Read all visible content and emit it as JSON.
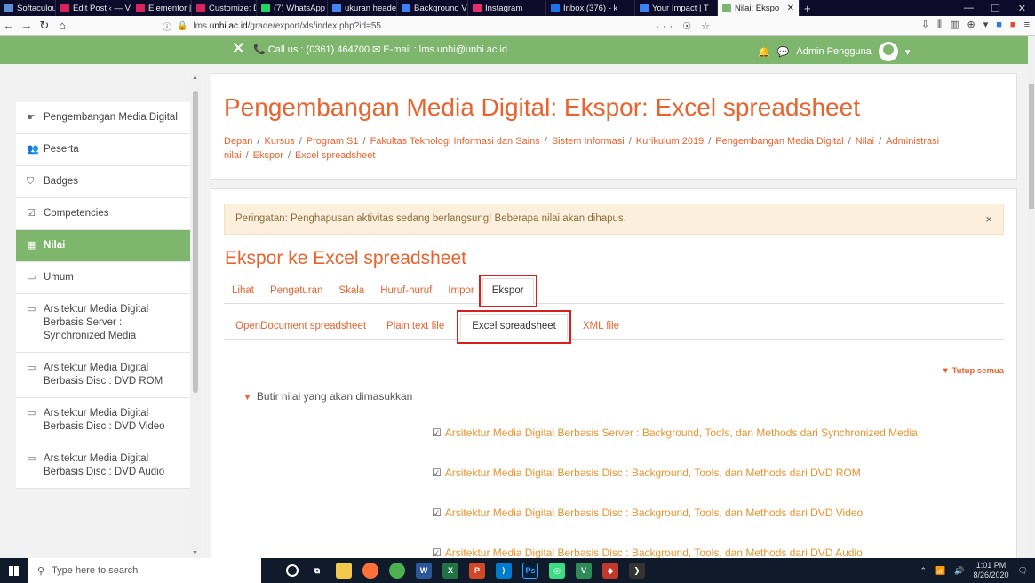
{
  "browser": {
    "tabs": [
      {
        "label": "Softaculous - S",
        "color": "#5a8fd8"
      },
      {
        "label": "Edit Post ‹ — V",
        "color": "#d8245a"
      },
      {
        "label": "Elementor | De",
        "color": "#d8245a"
      },
      {
        "label": "Customize: De",
        "color": "#d8245a"
      },
      {
        "label": "(7) WhatsApp",
        "color": "#25d366"
      },
      {
        "label": "ukuran header",
        "color": "#4285f4"
      },
      {
        "label": "Background V",
        "color": "#3b82f6"
      },
      {
        "label": "Instagram",
        "color": "#e1306c"
      },
      {
        "label": "Inbox (376) - k",
        "color": "#1a73e8"
      },
      {
        "label": "Your Impact | T",
        "color": "#3b82f6"
      },
      {
        "label": "Nilai: Ekspo",
        "color": "#7fb66d",
        "active": true
      }
    ],
    "url_prefix": "lms.",
    "url_domain": "unhi.ac.id",
    "url_path": "/grade/export/xls/index.php?id=55",
    "url_actions": "··· ☉ ☆"
  },
  "site": {
    "contact": "📞 Call us : (0361) 464700 ✉ E-mail : lms.unhi@unhi.ac.id",
    "user_name": "Admin Pengguna"
  },
  "sidebar": {
    "items": [
      {
        "icon": "☛",
        "label": "Pengembangan Media Digital",
        "active": false,
        "icon_name": "graduation-cap-icon"
      },
      {
        "icon": "👥",
        "label": "Peserta",
        "active": false,
        "icon_name": "users-icon"
      },
      {
        "icon": "⛉",
        "label": "Badges",
        "active": false,
        "icon_name": "shield-icon"
      },
      {
        "icon": "☑",
        "label": "Competencies",
        "active": false,
        "icon_name": "checkbox-icon"
      },
      {
        "icon": "▦",
        "label": "Nilai",
        "active": true,
        "icon_name": "table-icon"
      },
      {
        "icon": "▭",
        "label": "Umum",
        "active": false,
        "icon_name": "folder-icon"
      },
      {
        "icon": "▭",
        "label": "Arsitektur Media Digital Berbasis Server : Synchronized Media",
        "active": false,
        "icon_name": "folder-icon"
      },
      {
        "icon": "▭",
        "label": "Arsitektur Media Digital Berbasis Disc : DVD ROM",
        "active": false,
        "icon_name": "folder-icon"
      },
      {
        "icon": "▭",
        "label": "Arsitektur Media Digital Berbasis Disc : DVD Video",
        "active": false,
        "icon_name": "folder-icon"
      },
      {
        "icon": "▭",
        "label": "Arsitektur Media Digital Berbasis Disc : DVD Audio",
        "active": false,
        "icon_name": "folder-icon"
      }
    ]
  },
  "header": {
    "title": "Pengembangan Media Digital: Ekspor: Excel spreadsheet",
    "breadcrumb": [
      "Depan",
      "Kursus",
      "Program S1",
      "Fakultas Teknologi Informasi dan Sains",
      "Sistem Informasi",
      "Kurikulum 2019",
      "Pengembangan Media Digital",
      "Nilai",
      "Administrasi nilai",
      "Ekspor",
      "Excel spreadsheet"
    ]
  },
  "main": {
    "alert": "Peringatan: Penghapusan aktivitas sedang berlangsung! Beberapa nilai akan dihapus.",
    "alert_close": "×",
    "section_title": "Ekspor ke Excel spreadsheet",
    "tabs": [
      {
        "label": "Lihat",
        "selected": false
      },
      {
        "label": "Pengaturan",
        "selected": false
      },
      {
        "label": "Skala",
        "selected": false
      },
      {
        "label": "Huruf-huruf",
        "selected": false
      },
      {
        "label": "Impor",
        "selected": false
      },
      {
        "label": "Ekspor",
        "selected": true
      }
    ],
    "subtabs": [
      {
        "label": "OpenDocument spreadsheet",
        "selected": false
      },
      {
        "label": "Plain text file",
        "selected": false
      },
      {
        "label": "Excel spreadsheet",
        "selected": true
      },
      {
        "label": "XML file",
        "selected": false
      }
    ],
    "collapse_all": "▼ Tutup semua",
    "legend": "Butir nilai yang akan dimasukkan",
    "items": [
      "Arsitektur Media Digital Berbasis Server : Background, Tools, dan Methods dari Synchronized Media",
      "Arsitektur Media Digital Berbasis Disc : Background, Tools, dan Methods dari DVD ROM",
      "Arsitektur Media Digital Berbasis Disc : Background, Tools, dan Methods dari DVD Video",
      "Arsitektur Media Digital Berbasis Disc : Background, Tools, dan Methods dari DVD Audio"
    ]
  },
  "taskbar": {
    "search_placeholder": "Type here to search",
    "time": "1:01 PM",
    "date": "8/26/2020"
  }
}
